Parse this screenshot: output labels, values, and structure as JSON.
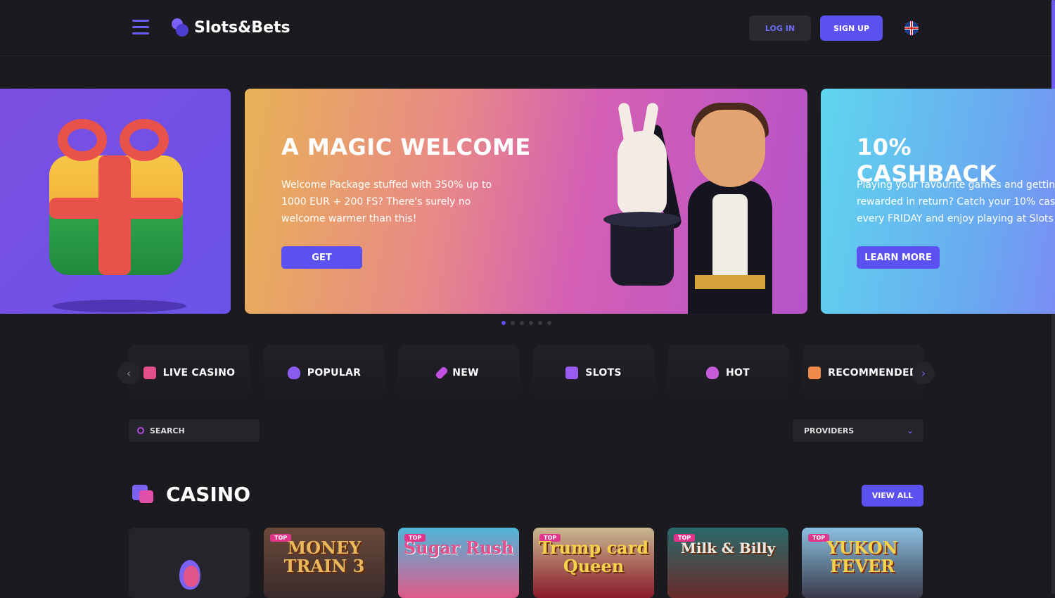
{
  "header": {
    "logo_text": "Slots&Bets",
    "login_label": "LOG IN",
    "signup_label": "SIGN UP",
    "language": "uk-flag-icon"
  },
  "banners": [
    {
      "title": "A MAGIC WELCOME",
      "text": "Welcome Package stuffed with 350% up to 1000 EUR + 200 FS? There's surely no welcome warmer than this!",
      "button": "GET"
    },
    {
      "title": "10% CASHBACK",
      "text": "Playing your favourite games and getting rewarded in return? Catch your 10% cash every FRIDAY and enjoy playing at Slots &",
      "button": "LEARN MORE"
    }
  ],
  "carousel": {
    "count": 6,
    "active": 0
  },
  "categories": [
    {
      "label": "LIVE CASINO",
      "icon": "live-casino-icon",
      "color": "#e24f8a"
    },
    {
      "label": "POPULAR",
      "icon": "flame-icon",
      "color": "#8a5cf0"
    },
    {
      "label": "NEW",
      "icon": "rocket-icon",
      "color": "#c24fe0"
    },
    {
      "label": "SLOTS",
      "icon": "slot-machine-icon",
      "color": "#9a5cf0"
    },
    {
      "label": "HOT",
      "icon": "hot-flame-icon",
      "color": "#c45cd8"
    },
    {
      "label": "RECOMMENDED",
      "icon": "thumbs-up-icon",
      "color": "#f08a4a"
    }
  ],
  "search": {
    "placeholder": "SEARCH"
  },
  "providers": {
    "label": "PROVIDERS"
  },
  "section": {
    "title": "CASINO",
    "view_all": "VIEW ALL"
  },
  "games": [
    {
      "title": "",
      "badge": ""
    },
    {
      "title": "MONEY TRAIN 3",
      "badge": "TOP"
    },
    {
      "title": "Sugar Rush",
      "badge": "TOP"
    },
    {
      "title": "Trump card Queen",
      "badge": "TOP"
    },
    {
      "title": "Milk & Billy",
      "badge": "TOP"
    },
    {
      "title": "YUKON FEVER",
      "badge": "TOP"
    }
  ],
  "colors": {
    "accent": "#5b50f0",
    "background": "#1b1a1f",
    "badge": "#e3348c"
  }
}
